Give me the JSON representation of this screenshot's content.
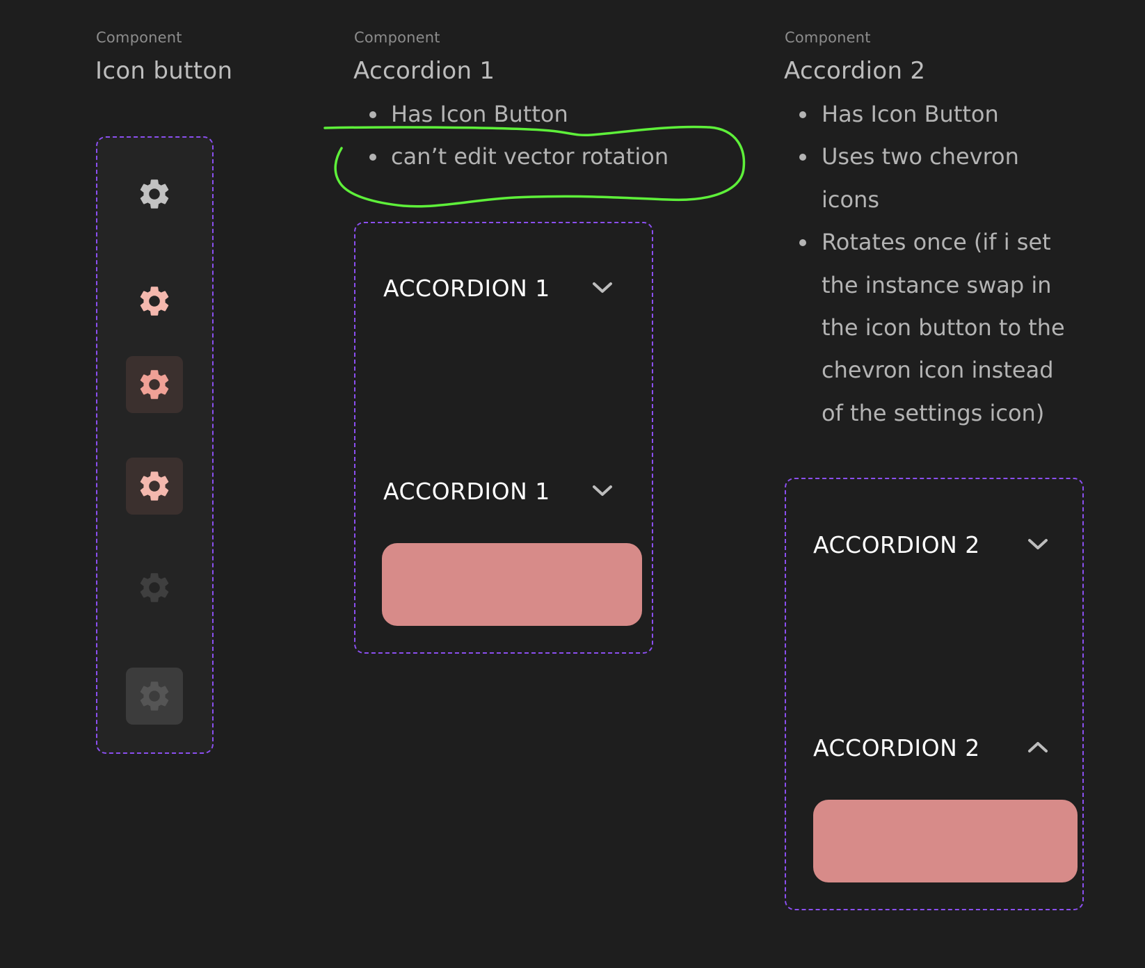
{
  "columns": [
    {
      "label": "Component",
      "title": "Icon button",
      "icon_button_states": [
        {
          "icon": "gear-icon",
          "state": "default",
          "icon_color": "#c2c2c2",
          "bg": "none"
        },
        {
          "icon": "gear-icon",
          "state": "hover",
          "icon_color": "#f4b8ae",
          "bg": "none"
        },
        {
          "icon": "gear-icon",
          "state": "active",
          "icon_color": "#f0a196",
          "bg": "#3b302e"
        },
        {
          "icon": "gear-icon",
          "state": "focused",
          "icon_color": "#f4b8ae",
          "bg": "#3b302e"
        },
        {
          "icon": "gear-icon",
          "state": "disabled",
          "icon_color": "#3f3f3f",
          "bg": "none"
        },
        {
          "icon": "gear-icon",
          "state": "disabled-filled",
          "icon_color": "#555555",
          "bg": "#3c3c3c"
        }
      ]
    },
    {
      "label": "Component",
      "title": "Accordion 1",
      "notes": [
        "Has Icon Button",
        "can’t edit vector rotation"
      ],
      "variants": [
        {
          "header": "ACCORDION 1",
          "chevron": "chevron-down-icon",
          "expanded": false
        },
        {
          "header": "ACCORDION 1",
          "chevron": "chevron-down-icon",
          "expanded": true
        }
      ]
    },
    {
      "label": "Component",
      "title": "Accordion 2",
      "notes": [
        [
          "Has Icon Button"
        ],
        [
          "Uses two chevron",
          "icons"
        ],
        [
          "Rotates once (if i set",
          "the instance swap in",
          "the icon button to the",
          "chevron icon instead",
          "of the settings icon)"
        ]
      ],
      "variants": [
        {
          "header": "ACCORDION 2",
          "chevron": "chevron-down-icon",
          "expanded": false
        },
        {
          "header": "ACCORDION 2",
          "chevron": "chevron-up-icon",
          "expanded": true
        }
      ]
    }
  ],
  "colors": {
    "background": "#1e1e1e",
    "component_border": "#8b4ff0",
    "content_fill": "#d78b89",
    "annotation_stroke": "#5ef03a"
  }
}
